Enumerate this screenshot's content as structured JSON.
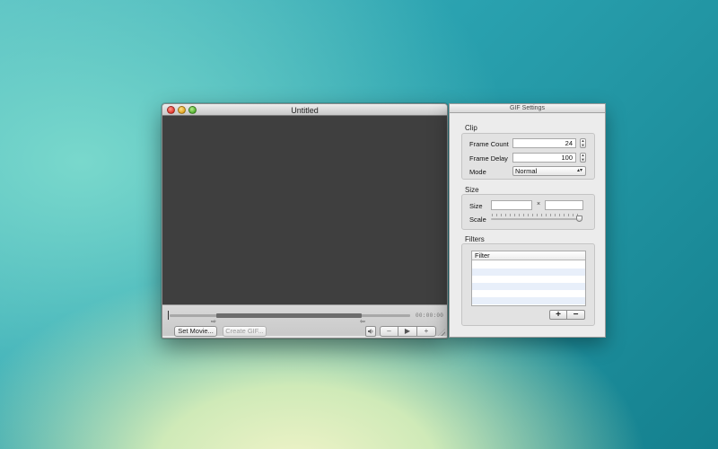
{
  "movie_window": {
    "title": "Untitled",
    "timecode": "00:00:00",
    "set_movie_label": "Set Movie...",
    "create_gif_label": "Create GIF...",
    "controls": {
      "volume_icon": "speaker-icon",
      "step_back": "–",
      "play": "▶",
      "step_forward": "+"
    }
  },
  "gif_settings": {
    "title": "GIF Settings",
    "clip": {
      "heading": "Clip",
      "frame_count_label": "Frame Count",
      "frame_count_value": "24",
      "frame_delay_label": "Frame Delay",
      "frame_delay_value": "100",
      "mode_label": "Mode",
      "mode_value": "Normal"
    },
    "size": {
      "heading": "Size",
      "size_label": "Size",
      "width_value": "",
      "times": "×",
      "height_value": "",
      "scale_label": "Scale",
      "scale_fraction": 1.0
    },
    "filters": {
      "heading": "Filters",
      "column_header": "Filter",
      "rows": [],
      "add_label": "+",
      "remove_label": "−"
    }
  },
  "colors": {
    "movie_area": "#3f3f3f",
    "table_alt_row": "#e8effa"
  }
}
